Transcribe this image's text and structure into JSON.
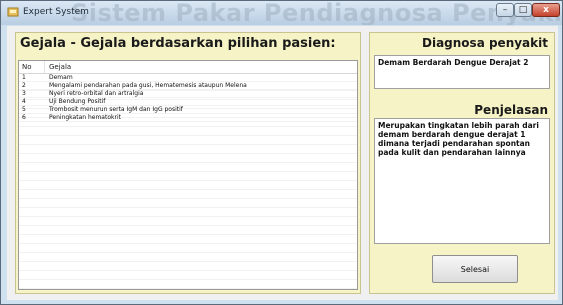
{
  "window": {
    "title": "Expert System",
    "watermark": "Sistem Pakar Pendiagnosa Penyakit Demam Typ",
    "controls": {
      "minimize": "–",
      "maximize": "□",
      "close": "x"
    }
  },
  "left": {
    "title": "Gejala - Gejala berdasarkan pilihan pasien:",
    "columns": {
      "no": "No",
      "gejala": "Gejala"
    },
    "rows": [
      {
        "no": "1",
        "gejala": "Demam"
      },
      {
        "no": "2",
        "gejala": "Mengalami pendarahan pada gusi, Hematemesis ataupun Melena"
      },
      {
        "no": "3",
        "gejala": "Nyeri retro-orbital dan artralgia"
      },
      {
        "no": "4",
        "gejala": "Uji Bendung Positif"
      },
      {
        "no": "5",
        "gejala": "Trombosit menurun serta IgM dan IgG positif"
      },
      {
        "no": "6",
        "gejala": "Peningkatan hematokrit"
      }
    ]
  },
  "right": {
    "diagnosa_title": "Diagnosa penyakit",
    "diagnosa_value": "Demam Berdarah Dengue Derajat 2",
    "penjelasan_title": "Penjelasan",
    "penjelasan_value": "Merupakan tingkatan lebih parah dari demam berdarah dengue derajat 1 dimana terjadi pendarahan spontan pada kulit dan pendarahan lainnya",
    "button_label": "Selesai"
  }
}
